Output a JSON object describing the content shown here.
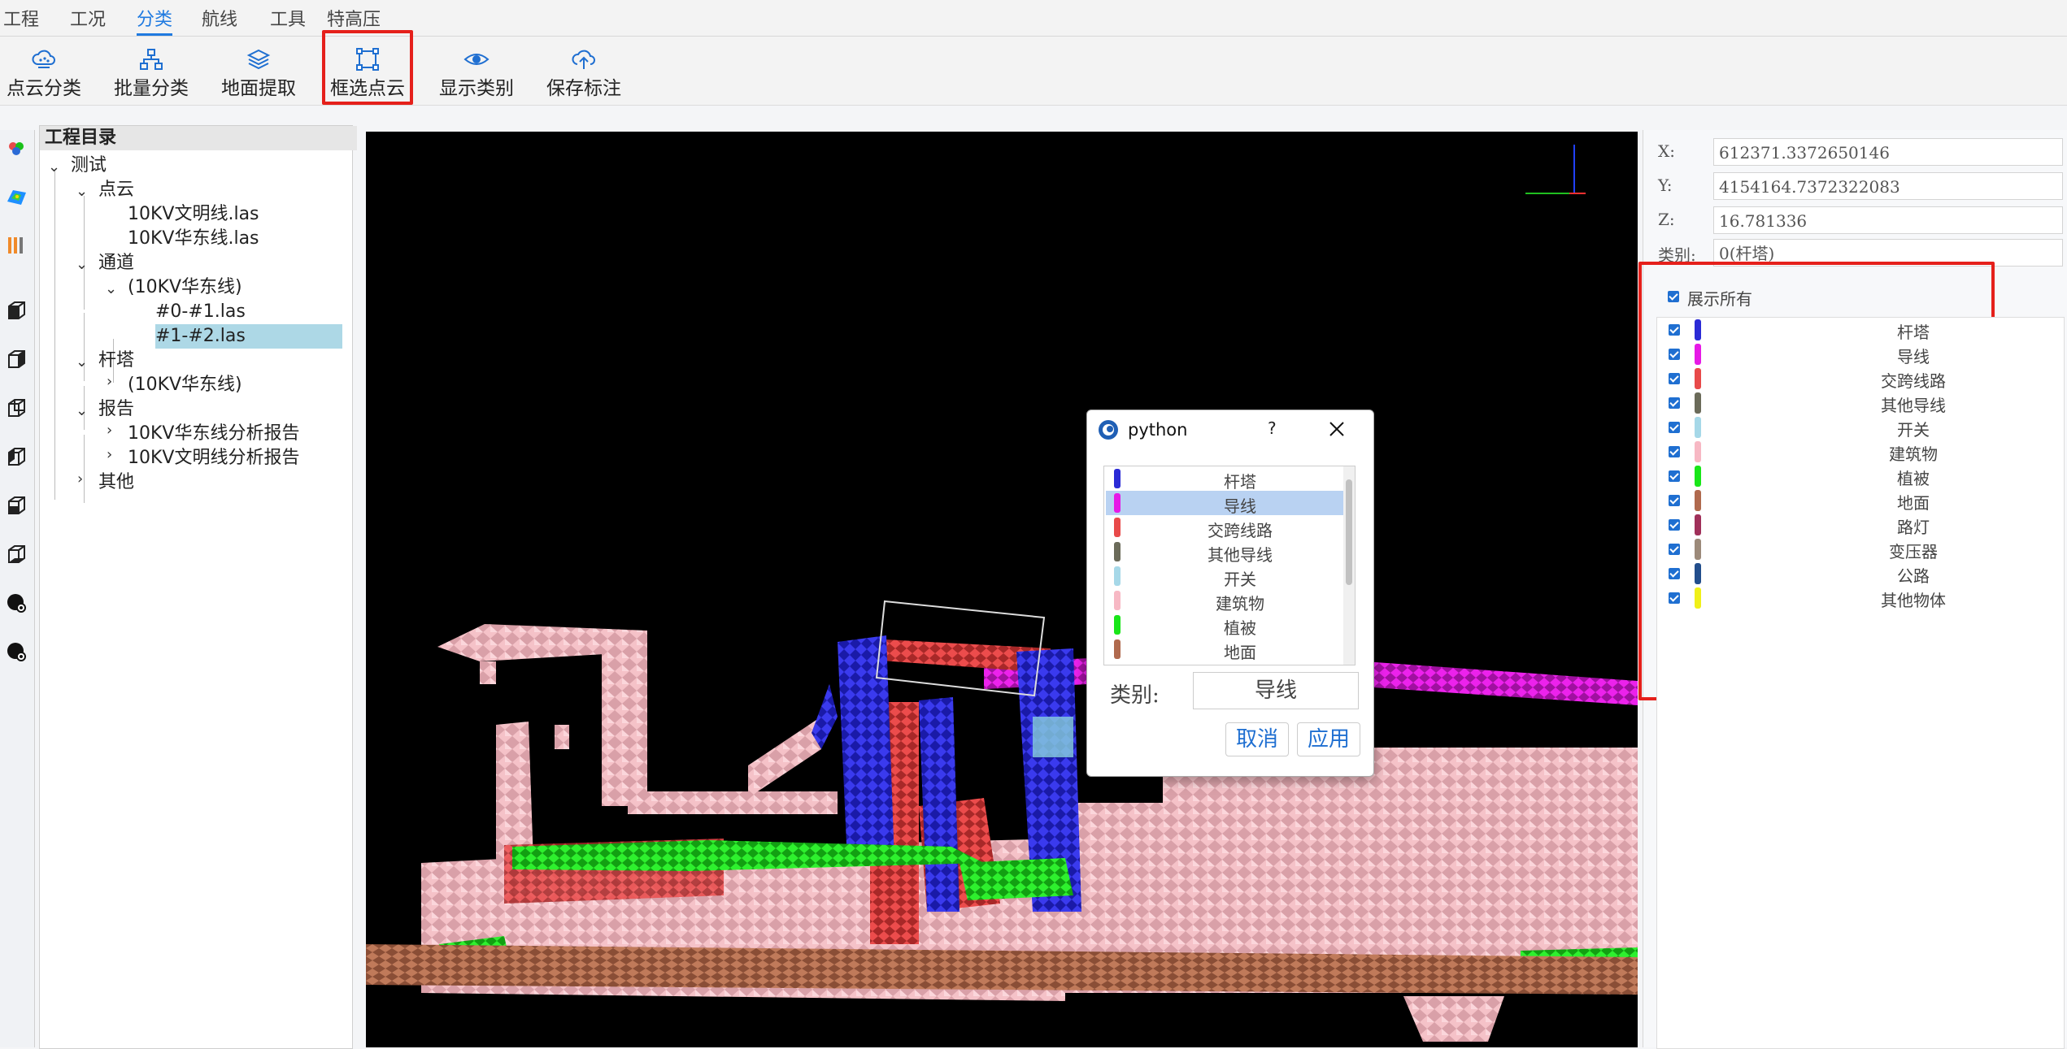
{
  "menu": {
    "items": [
      {
        "label": "工程"
      },
      {
        "label": "工况"
      },
      {
        "label": "分类"
      },
      {
        "label": "航线"
      },
      {
        "label": "工具"
      },
      {
        "label": "特高压"
      }
    ],
    "active": "分类"
  },
  "toolbar": {
    "tools": [
      {
        "label": "点云分类",
        "icon": "cloud-classify-icon"
      },
      {
        "label": "批量分类",
        "icon": "hierarchy-icon"
      },
      {
        "label": "地面提取",
        "icon": "layers-icon"
      },
      {
        "label": "框选点云",
        "icon": "box-select-icon",
        "highlighted": true
      },
      {
        "label": "显示类别",
        "icon": "eye-icon"
      },
      {
        "label": "保存标注",
        "icon": "cloud-upload-icon"
      }
    ]
  },
  "tree": {
    "header": "工程目录",
    "nodes": [
      {
        "label": "测试",
        "expanded": true
      },
      {
        "label": "点云",
        "expanded": true
      },
      {
        "label": "10KV文明线.las"
      },
      {
        "label": "10KV华东线.las"
      },
      {
        "label": "通道",
        "expanded": true
      },
      {
        "label": "(10KV华东线)",
        "expanded": true
      },
      {
        "label": "#0-#1.las"
      },
      {
        "label": "#1-#2.las",
        "selected": true
      },
      {
        "label": "杆塔",
        "expanded": true
      },
      {
        "label": "(10KV华东线)",
        "expanded": false
      },
      {
        "label": "报告",
        "expanded": true
      },
      {
        "label": "10KV华东线分析报告",
        "expanded": false
      },
      {
        "label": "10KV文明线分析报告",
        "expanded": false
      },
      {
        "label": "其他",
        "expanded": false
      }
    ]
  },
  "info": {
    "x_label": "X:",
    "x_value": "612371.3372650146",
    "y_label": "Y:",
    "y_value": "4154164.7372322083",
    "z_label": "Z:",
    "z_value": "16.781336",
    "cls_label": "类别:",
    "cls_value": "0(杆塔)"
  },
  "classes": {
    "show_all_label": "展示所有",
    "items": [
      {
        "name": "杆塔",
        "color": "#2b2bd6"
      },
      {
        "name": "导线",
        "color": "#e619e6"
      },
      {
        "name": "交跨线路",
        "color": "#e84a4a"
      },
      {
        "name": "其他导线",
        "color": "#6b6b5a"
      },
      {
        "name": "开关",
        "color": "#a6d8e8"
      },
      {
        "name": "建筑物",
        "color": "#f7b8c4"
      },
      {
        "name": "植被",
        "color": "#19e619"
      },
      {
        "name": "地面",
        "color": "#b06a4e"
      },
      {
        "name": "路灯",
        "color": "#a0305a"
      },
      {
        "name": "变压器",
        "color": "#9c8a7a"
      },
      {
        "name": "公路",
        "color": "#224e8c"
      },
      {
        "name": "其他物体",
        "color": "#f0f019"
      }
    ]
  },
  "dialog": {
    "title": "python",
    "help_glyph": "?",
    "list": [
      {
        "name": "杆塔",
        "color": "#2b2bd6"
      },
      {
        "name": "导线",
        "color": "#e619e6",
        "selected": true
      },
      {
        "name": "交跨线路",
        "color": "#e84a4a"
      },
      {
        "name": "其他导线",
        "color": "#6b6b5a"
      },
      {
        "name": "开关",
        "color": "#a6d8e8"
      },
      {
        "name": "建筑物",
        "color": "#f7b8c4"
      },
      {
        "name": "植被",
        "color": "#19e619"
      },
      {
        "name": "地面",
        "color": "#b06a4e"
      }
    ],
    "category_label": "类别:",
    "category_value": "导线",
    "cancel_label": "取消",
    "apply_label": "应用"
  }
}
